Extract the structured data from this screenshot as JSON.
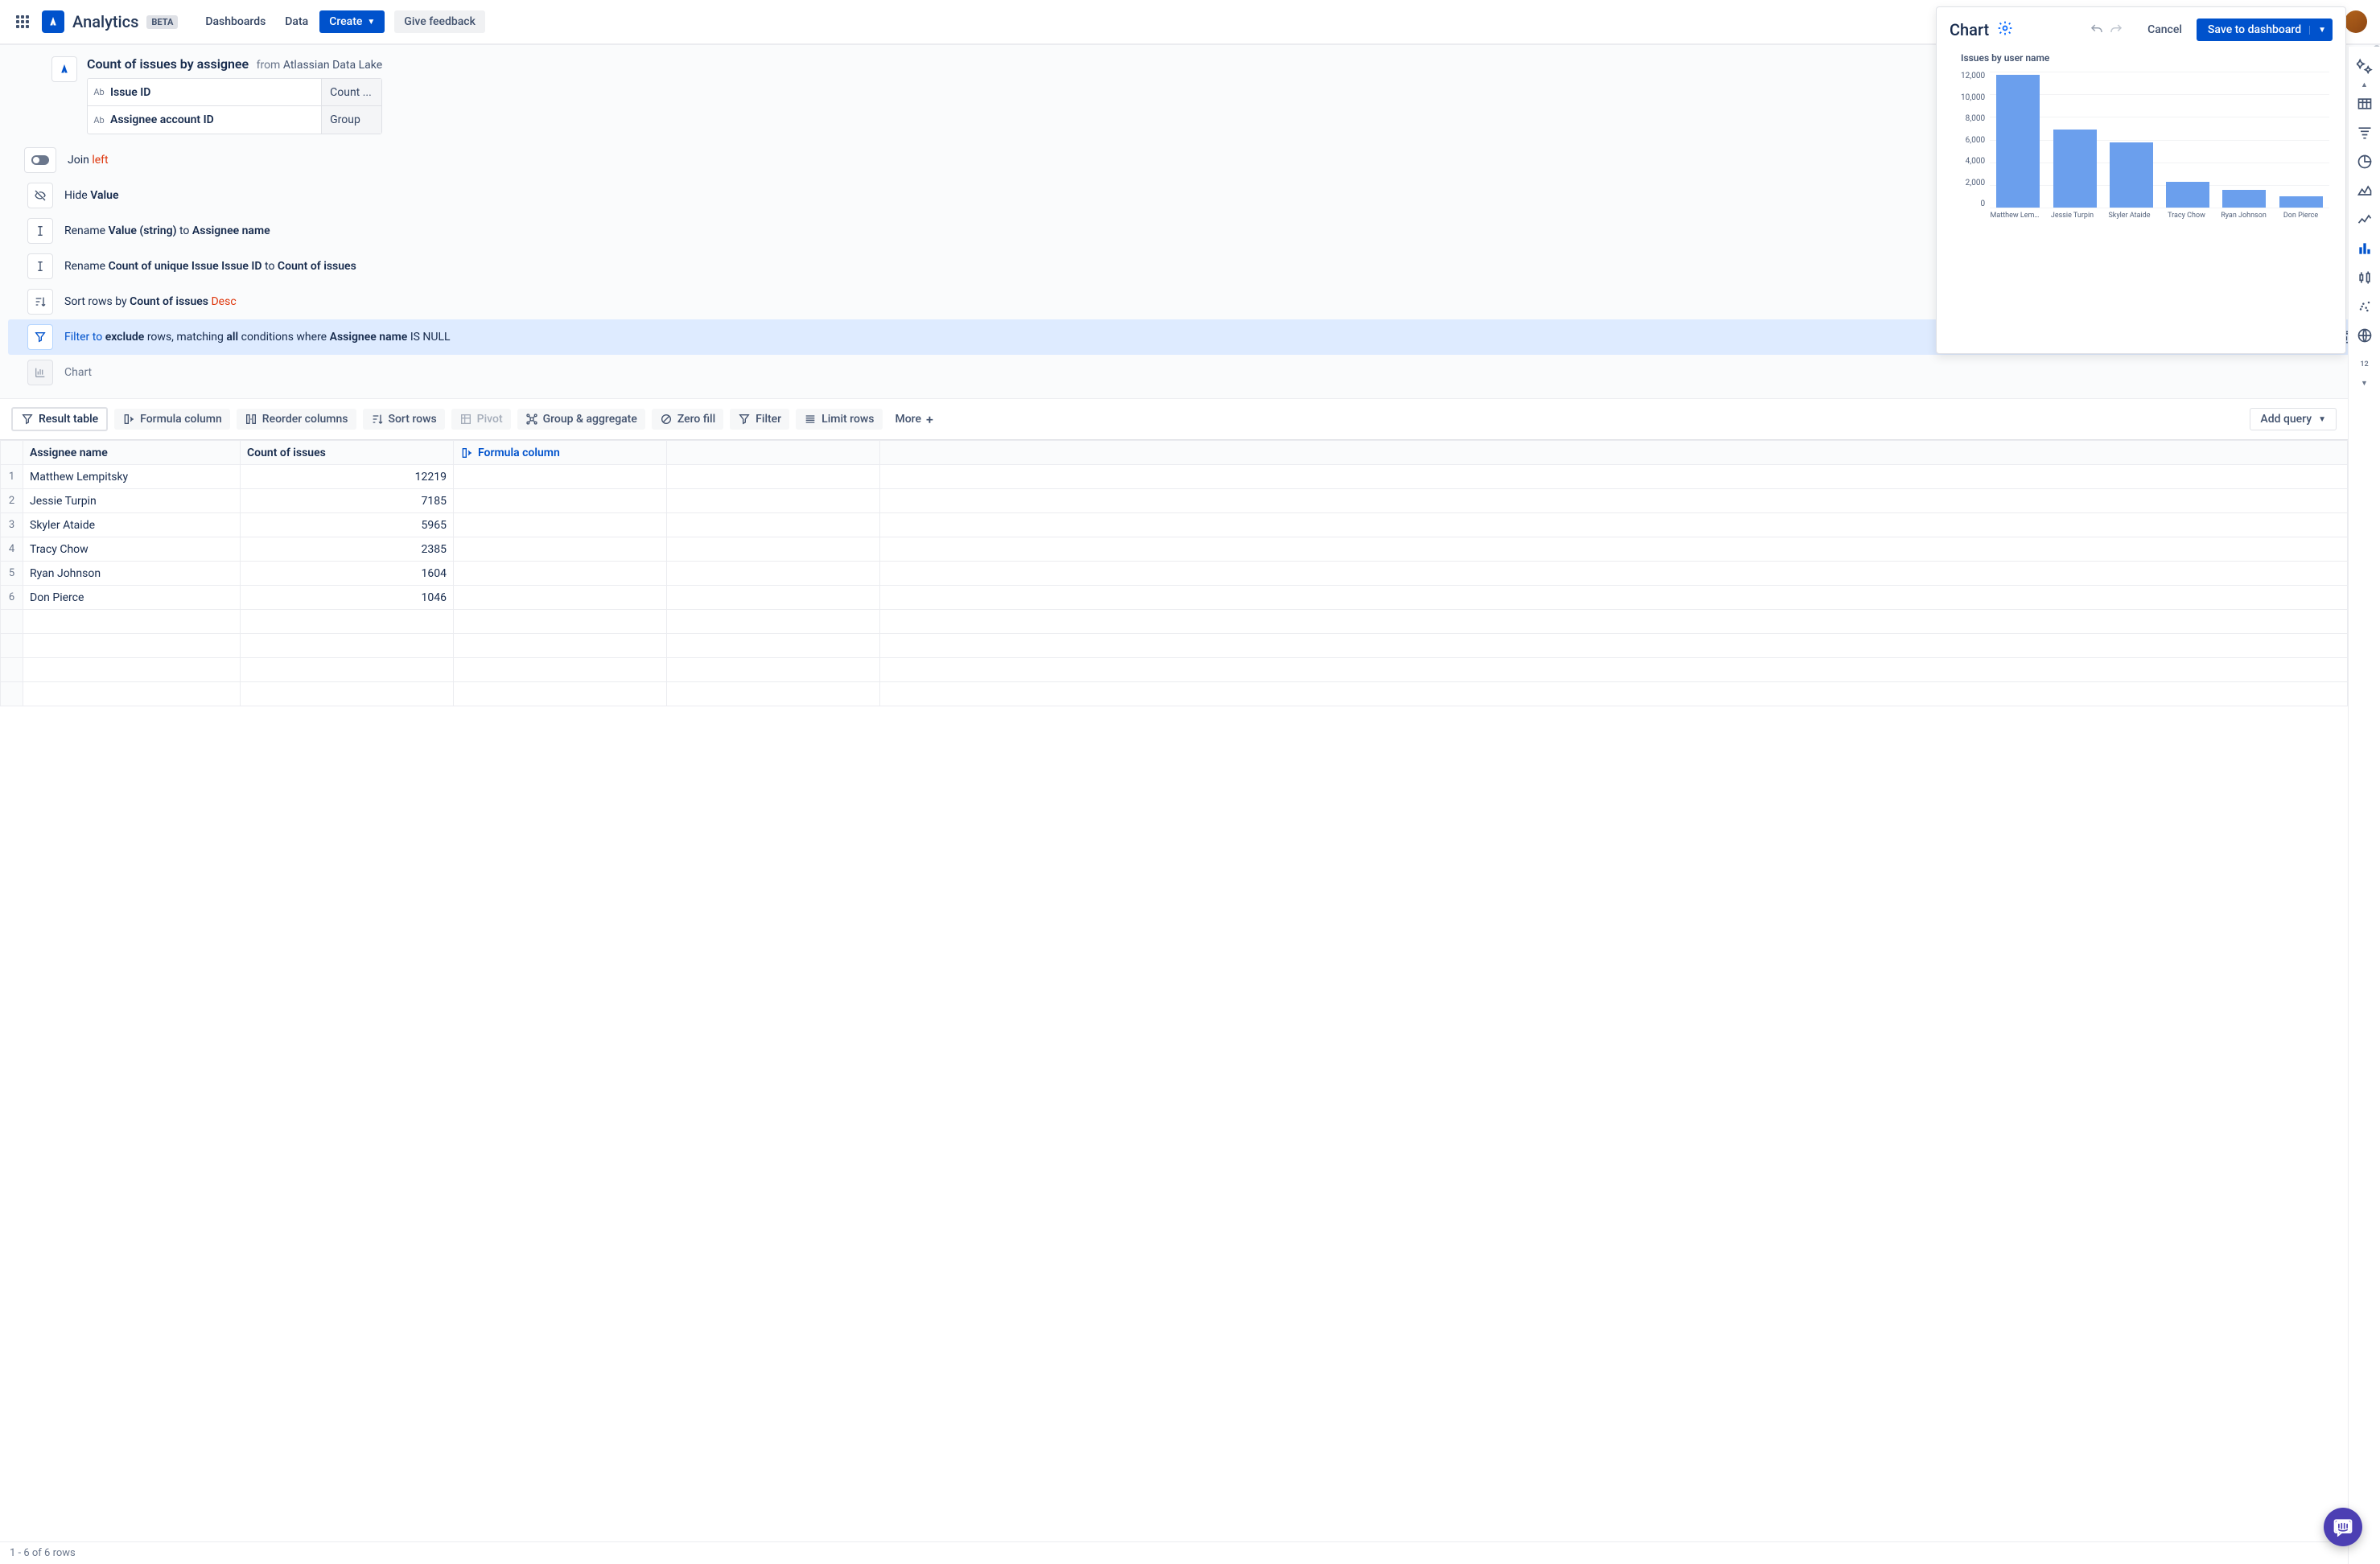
{
  "nav": {
    "product": "Analytics",
    "beta": "BETA",
    "dashboards": "Dashboards",
    "data": "Data",
    "create": "Create",
    "feedback": "Give feedback",
    "search_placeholder": ""
  },
  "query": {
    "title": "Count of issues by assignee",
    "from": "from",
    "source": "Atlassian Data Lake",
    "fields": [
      {
        "type": "Ab",
        "name": "Issue ID",
        "agg": "Count ..."
      },
      {
        "type": "Ab",
        "name": "Assignee account ID",
        "agg": "Group"
      }
    ]
  },
  "steps": {
    "join_label": "Join",
    "join_type": "left",
    "hide_prefix": "Hide",
    "hide_target": "Value",
    "rename1_prefix": "Rename",
    "rename1_from": "Value (string)",
    "rename1_to_word": "to",
    "rename1_to": "Assignee name",
    "rename2_prefix": "Rename",
    "rename2_from": "Count of unique Issue Issue ID",
    "rename2_to_word": "to",
    "rename2_to": "Count of issues",
    "sort_prefix": "Sort rows by",
    "sort_col": "Count of issues",
    "sort_dir": "Desc",
    "filter_prefix": "Filter to",
    "filter_mode": "exclude",
    "filter_mid1": "rows, matching",
    "filter_all": "all",
    "filter_mid2": "conditions where",
    "filter_col": "Assignee name",
    "filter_cond": "IS NULL",
    "chart_step": "Chart"
  },
  "chart_panel": {
    "heading": "Chart",
    "cancel": "Cancel",
    "save": "Save to dashboard",
    "title": "Issues by user name"
  },
  "chart_data": {
    "type": "bar",
    "title": "Issues by user name",
    "categories": [
      "Matthew Lempits...",
      "Jessie Turpin",
      "Skyler Ataide",
      "Tracy Chow",
      "Ryan Johnson",
      "Don Pierce"
    ],
    "values": [
      12219,
      7185,
      5965,
      2385,
      1604,
      1046
    ],
    "y_ticks": [
      "12,000",
      "10,000",
      "8,000",
      "6,000",
      "4,000",
      "2,000",
      "0"
    ],
    "ylim": [
      0,
      12500
    ],
    "xlabel": "",
    "ylabel": ""
  },
  "toolbar": {
    "result": "Result table",
    "formula": "Formula column",
    "reorder": "Reorder columns",
    "sort": "Sort rows",
    "pivot": "Pivot",
    "group": "Group & aggregate",
    "zero": "Zero fill",
    "filter": "Filter",
    "limit": "Limit rows",
    "more": "More",
    "add_query": "Add query"
  },
  "table": {
    "headers": [
      "Assignee name",
      "Count of issues"
    ],
    "formula_col": "Formula column",
    "rows": [
      {
        "name": "Matthew Lempitsky",
        "count": "12219"
      },
      {
        "name": "Jessie Turpin",
        "count": "7185"
      },
      {
        "name": "Skyler Ataide",
        "count": "5965"
      },
      {
        "name": "Tracy Chow",
        "count": "2385"
      },
      {
        "name": "Ryan Johnson",
        "count": "1604"
      },
      {
        "name": "Don Pierce",
        "count": "1046"
      }
    ]
  },
  "footer": {
    "status": "1 - 6 of 6 rows"
  }
}
